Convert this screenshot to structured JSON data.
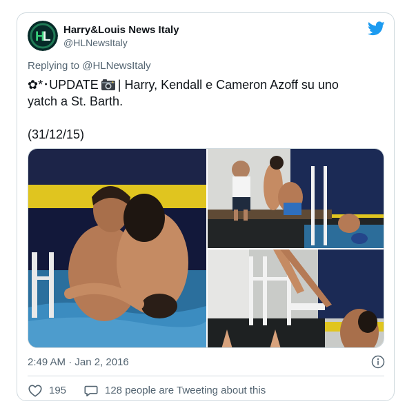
{
  "tweet": {
    "author_name": "Harry&Louis News Italy",
    "author_handle": "@HLNewsItaly",
    "replying_prefix": "Replying to ",
    "replying_to": "@HLNewsItaly",
    "text_line1_prefix": "✿*･UPDATE",
    "text_line1_suffix": "| Harry, Kendall e Cameron Azoff su uno",
    "text_line2": "yatch a St. Barth.",
    "text_line3": "(31/12/15)",
    "timestamp": "2:49 AM · Jan 2, 2016",
    "like_count": "195",
    "tweeting_text": "128 people are Tweeting about this"
  },
  "colors": {
    "twitter_blue": "#1d9bf0",
    "muted_text": "#536471",
    "border": "#cfd9de",
    "avatar_bg": "#0b3d3a",
    "avatar_letter": "#38d27b"
  },
  "icons": {
    "twitter": "twitter-bird-icon",
    "camera": "camera-icon",
    "info": "info-icon",
    "like": "heart-icon",
    "reply": "speech-bubble-icon"
  },
  "media": {
    "count": 3
  }
}
